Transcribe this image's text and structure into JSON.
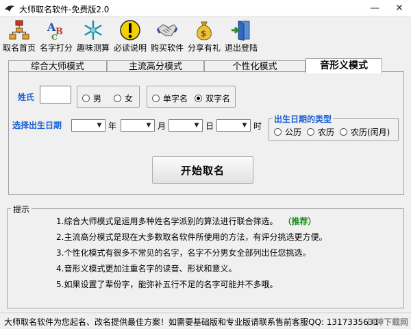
{
  "window": {
    "title": "大师取名软件-免费版2.0",
    "minimize": "—",
    "close": "✕"
  },
  "toolbar": {
    "items": [
      {
        "label": "取名首页",
        "icon": "org-chart-icon"
      },
      {
        "label": "名字打分",
        "icon": "abc-letters-icon"
      },
      {
        "label": "趣味测算",
        "icon": "snowflake-icon"
      },
      {
        "label": "必读说明",
        "icon": "warning-icon"
      },
      {
        "label": "购买软件",
        "icon": "handshake-icon"
      },
      {
        "label": "分享有礼",
        "icon": "money-bag-icon"
      },
      {
        "label": "退出登陆",
        "icon": "exit-door-icon"
      }
    ]
  },
  "tabs": [
    {
      "label": "综合大师模式"
    },
    {
      "label": "主流高分模式"
    },
    {
      "label": "个性化模式"
    },
    {
      "label": "音形义模式",
      "active": true
    }
  ],
  "form": {
    "surname_label": "姓氏",
    "surname_value": "",
    "gender": {
      "options": [
        "男",
        "女"
      ],
      "selected": -1
    },
    "name_length": {
      "options": [
        "单字名",
        "双字名"
      ],
      "selected": 1
    },
    "birth_label": "选择出生日期",
    "year_unit": "年",
    "month_unit": "月",
    "day_unit": "日",
    "hour_unit": "时",
    "date_type_legend": "出生日期的类型",
    "date_type": {
      "options": [
        "公历",
        "农历",
        "农历(闰月)"
      ],
      "selected": -1
    },
    "start_button": "开始取名"
  },
  "hints": {
    "legend": "提示",
    "lines": [
      "1.综合大师模式是运用多种姓名学派别的算法进行联合筛选。",
      "2.主流高分模式是现在大多数取名软件所使用的方法，有评分挑选更方便。",
      "3.个性化模式有很多不常见的名字，名字不分男女全部列出任您挑选。",
      "4.音形义模式更加注重名字的读音、形状和意义。",
      "5.如果设置了辈份字，能弥补五行不足的名字可能并不多哦。"
    ],
    "recommend": "（推荐）"
  },
  "status": {
    "text": "大师取名软件为您起名、改名提供最佳方案！如需要基础版和专业版请联系售前客服QQ: 1317335631",
    "watermark": "川神下载网"
  },
  "colors": {
    "label_blue": "#1a5fd6",
    "recommend_green": "#1b8a1b"
  }
}
